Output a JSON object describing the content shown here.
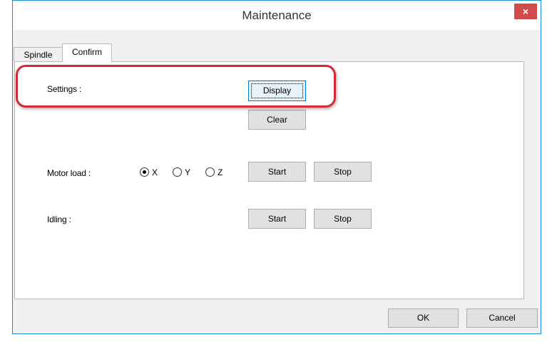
{
  "window": {
    "title": "Maintenance",
    "close_glyph": "×"
  },
  "tabs": [
    {
      "label": "Spindle",
      "active": false
    },
    {
      "label": "Confirm",
      "active": true
    }
  ],
  "settings": {
    "label": "Settings :",
    "display_button": "Display",
    "clear_button": "Clear"
  },
  "motor_load": {
    "label": "Motor load :",
    "axes": [
      {
        "label": "X",
        "selected": true
      },
      {
        "label": "Y",
        "selected": false
      },
      {
        "label": "Z",
        "selected": false
      }
    ],
    "start_button": "Start",
    "stop_button": "Stop"
  },
  "idling": {
    "label": "Idling :",
    "start_button": "Start",
    "stop_button": "Stop"
  },
  "footer": {
    "ok_button": "OK",
    "cancel_button": "Cancel"
  },
  "colors": {
    "highlight": "#d42a35",
    "close_button": "#d04b4b",
    "window_border": "#1a8fd6"
  }
}
